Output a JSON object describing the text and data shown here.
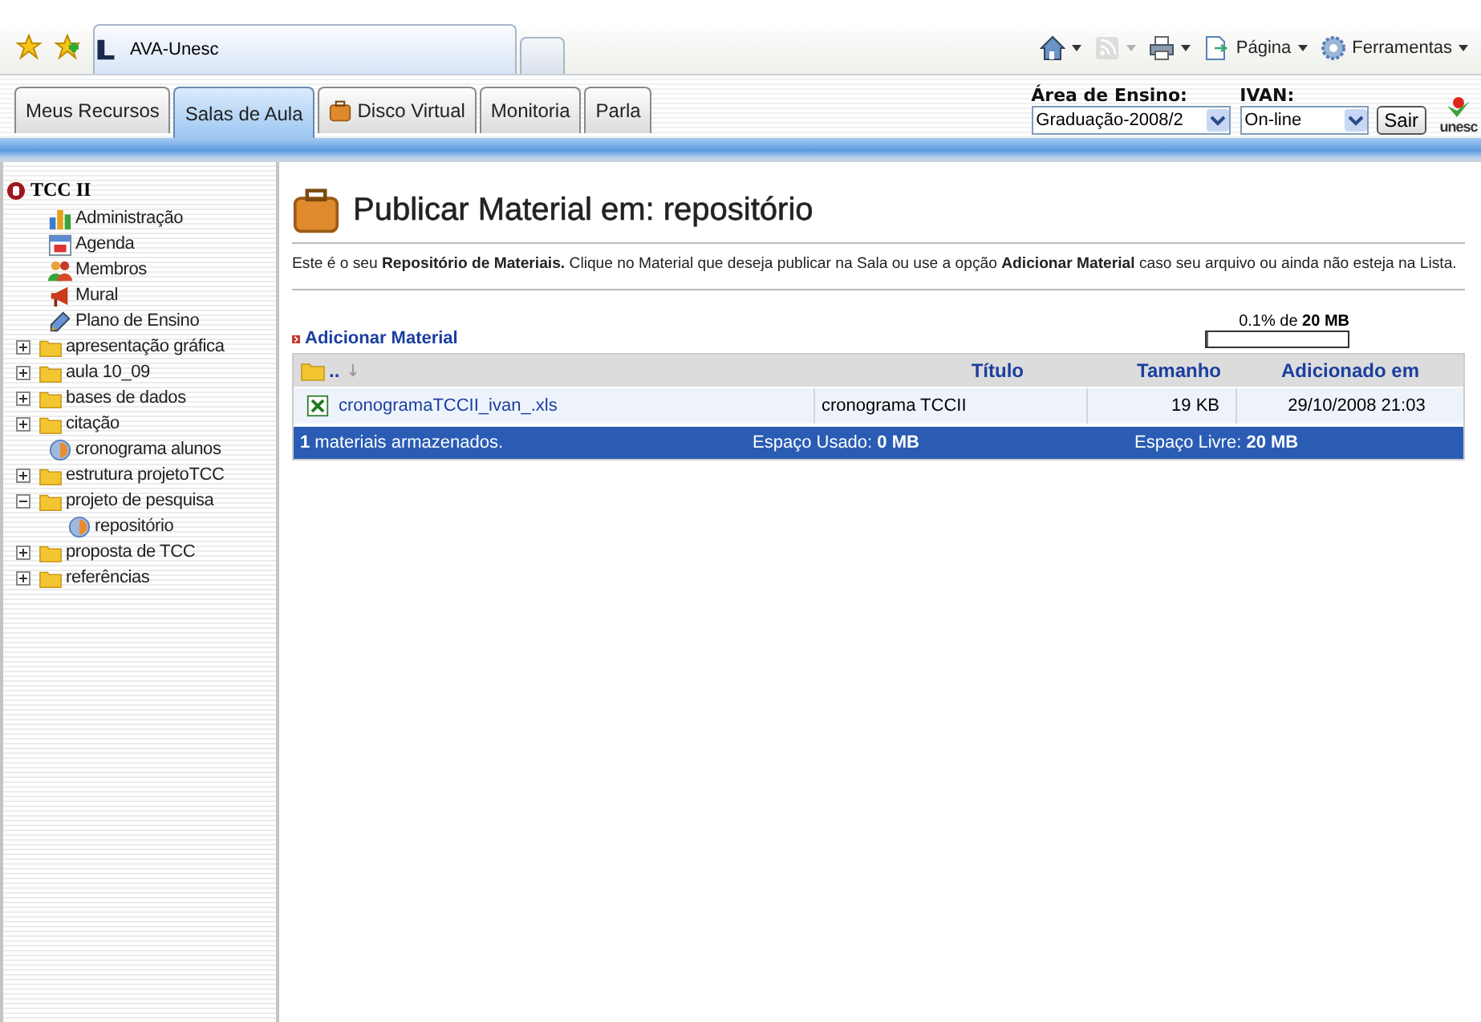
{
  "browser": {
    "tab_title": "AVA-Unesc",
    "commands": [
      {
        "kind": "home"
      },
      {
        "kind": "feeds"
      },
      {
        "kind": "print"
      },
      {
        "kind": "page",
        "label": "Página"
      },
      {
        "kind": "tools",
        "label": "Ferramentas"
      }
    ]
  },
  "nav_tabs": [
    {
      "label": "Meus Recursos",
      "selected": false,
      "kind": "plain"
    },
    {
      "label": "Salas de Aula",
      "selected": true,
      "kind": "plain"
    },
    {
      "label": "Disco Virtual",
      "selected": false,
      "kind": "briefcase"
    },
    {
      "label": "Monitoria",
      "selected": false,
      "kind": "plain"
    },
    {
      "label": "Parla",
      "selected": false,
      "kind": "plain"
    }
  ],
  "header": {
    "area_label": "Área de Ensino:",
    "area_value": "Graduação-2008/2",
    "user_label": "IVAN:",
    "status_value": "On-line",
    "logout": "Sair",
    "logo": "unesc"
  },
  "sidebar": {
    "course": "TCC II",
    "items": [
      {
        "label": "Administração",
        "kind": "admin"
      },
      {
        "label": "Agenda",
        "kind": "agenda"
      },
      {
        "label": "Membros",
        "kind": "members"
      },
      {
        "label": "Mural",
        "kind": "mural"
      },
      {
        "label": "Plano de Ensino",
        "kind": "plan"
      },
      {
        "label": "apresentação gráfica",
        "kind": "folder",
        "expanded": false
      },
      {
        "label": "aula 10_09",
        "kind": "folder",
        "expanded": false
      },
      {
        "label": "bases de dados",
        "kind": "folder",
        "expanded": false
      },
      {
        "label": "citação",
        "kind": "folder",
        "expanded": false
      },
      {
        "label": "cronograma alunos",
        "kind": "page"
      },
      {
        "label": "estrutura projetoTCC",
        "kind": "folder",
        "expanded": false
      },
      {
        "label": "projeto de pesquisa",
        "kind": "folder",
        "expanded": true,
        "children": [
          {
            "label": "repositório",
            "kind": "page"
          }
        ]
      },
      {
        "label": "proposta de TCC",
        "kind": "folder",
        "expanded": false
      },
      {
        "label": "referências",
        "kind": "folder",
        "expanded": false
      }
    ]
  },
  "main": {
    "title": "Publicar Material em: repositório",
    "intro": "Este é o seu **Repositório de Materiais.** Clique no Material que deseja publicar na Sala ou use a opção **Adicionar Material** caso seu arquivo ou ainda não esteja na Lista.",
    "add_link": "Adicionar Material",
    "quota": {
      "text": "0.1% de **20 MB**",
      "level": 0.001
    },
    "table": {
      "columns": [
        "..",
        "Título",
        "Tamanho",
        "Adicionado em"
      ],
      "rows": [
        {
          "file": "cronogramaTCCII_ivan_.xls",
          "title": "cronograma TCCII",
          "size": "19 KB",
          "date": "29/10/2008 21:03"
        }
      ],
      "footer": [
        "**1** materiais armazenados.",
        "Espaço Usado: **0 MB**",
        "Espaço Livre: **20 MB**"
      ]
    }
  }
}
